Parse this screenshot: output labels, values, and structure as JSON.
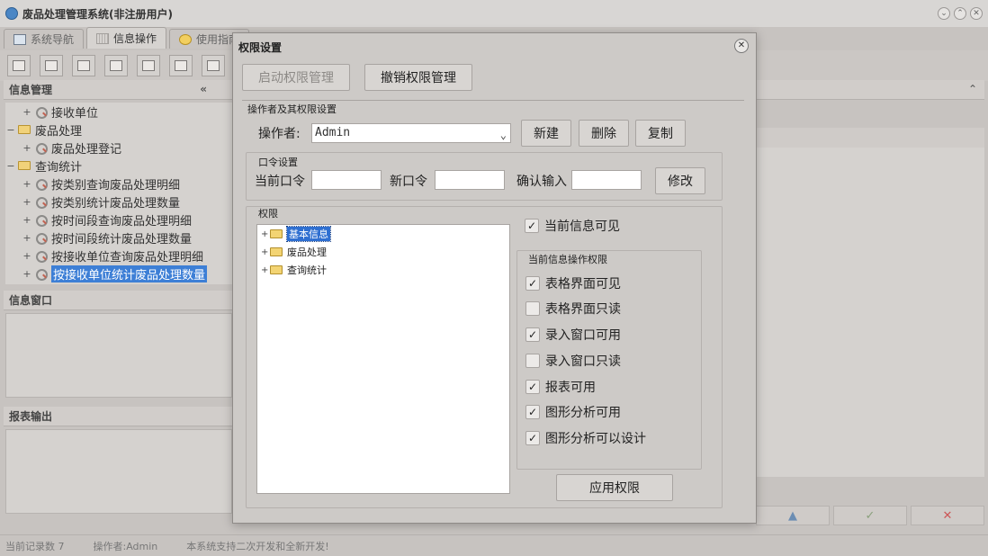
{
  "app": {
    "title": "废品处理管理系统(非注册用户)"
  },
  "tabs": [
    {
      "label": "系统导航"
    },
    {
      "label": "信息操作"
    },
    {
      "label": "使用指南"
    }
  ],
  "left": {
    "info_panel_title": "信息管理",
    "tree": [
      {
        "label": "接收单位",
        "level": 1
      },
      {
        "label": "废品处理",
        "level": 0
      },
      {
        "label": "废品处理登记",
        "level": 1
      },
      {
        "label": "查询统计",
        "level": 0
      },
      {
        "label": "按类别查询废品处理明细",
        "level": 1
      },
      {
        "label": "按类别统计废品处理数量",
        "level": 1
      },
      {
        "label": "按时间段查询废品处理明细",
        "level": 1
      },
      {
        "label": "按时间段统计废品处理数量",
        "level": 1
      },
      {
        "label": "按接收单位查询废品处理明细",
        "level": 1
      },
      {
        "label": "按接收单位统计废品处理数量",
        "level": 1
      }
    ],
    "info_window_title": "信息窗口",
    "report_output_title": "报表输出"
  },
  "status": {
    "record_count": "当前记录数 7",
    "operator": "操作者:Admin",
    "message": "本系统支持二次开发和全新开发!"
  },
  "dialog": {
    "title": "权限设置",
    "enable_btn": "启动权限管理",
    "revoke_btn": "撤销权限管理",
    "operator_group": "操作者及其权限设置",
    "operator_label": "操作者:",
    "operator_value": "Admin",
    "new_btn": "新建",
    "delete_btn": "删除",
    "copy_btn": "复制",
    "password_group": "口令设置",
    "current_pw_label": "当前口令",
    "new_pw_label": "新口令",
    "confirm_pw_label": "确认输入",
    "modify_btn": "修改",
    "perm_group": "权限",
    "perm_tree": [
      {
        "label": "基本信息"
      },
      {
        "label": "废品处理"
      },
      {
        "label": "查询统计"
      }
    ],
    "current_visible": "当前信息可见",
    "op_perm_group": "当前信息操作权限",
    "checks": [
      {
        "label": "表格界面可见",
        "checked": true
      },
      {
        "label": "表格界面只读",
        "checked": false
      },
      {
        "label": "录入窗口可用",
        "checked": true
      },
      {
        "label": "录入窗口只读",
        "checked": false
      },
      {
        "label": "报表可用",
        "checked": true
      },
      {
        "label": "图形分析可用",
        "checked": true
      },
      {
        "label": "图形分析可以设计",
        "checked": true
      }
    ],
    "apply_btn": "应用权限"
  }
}
